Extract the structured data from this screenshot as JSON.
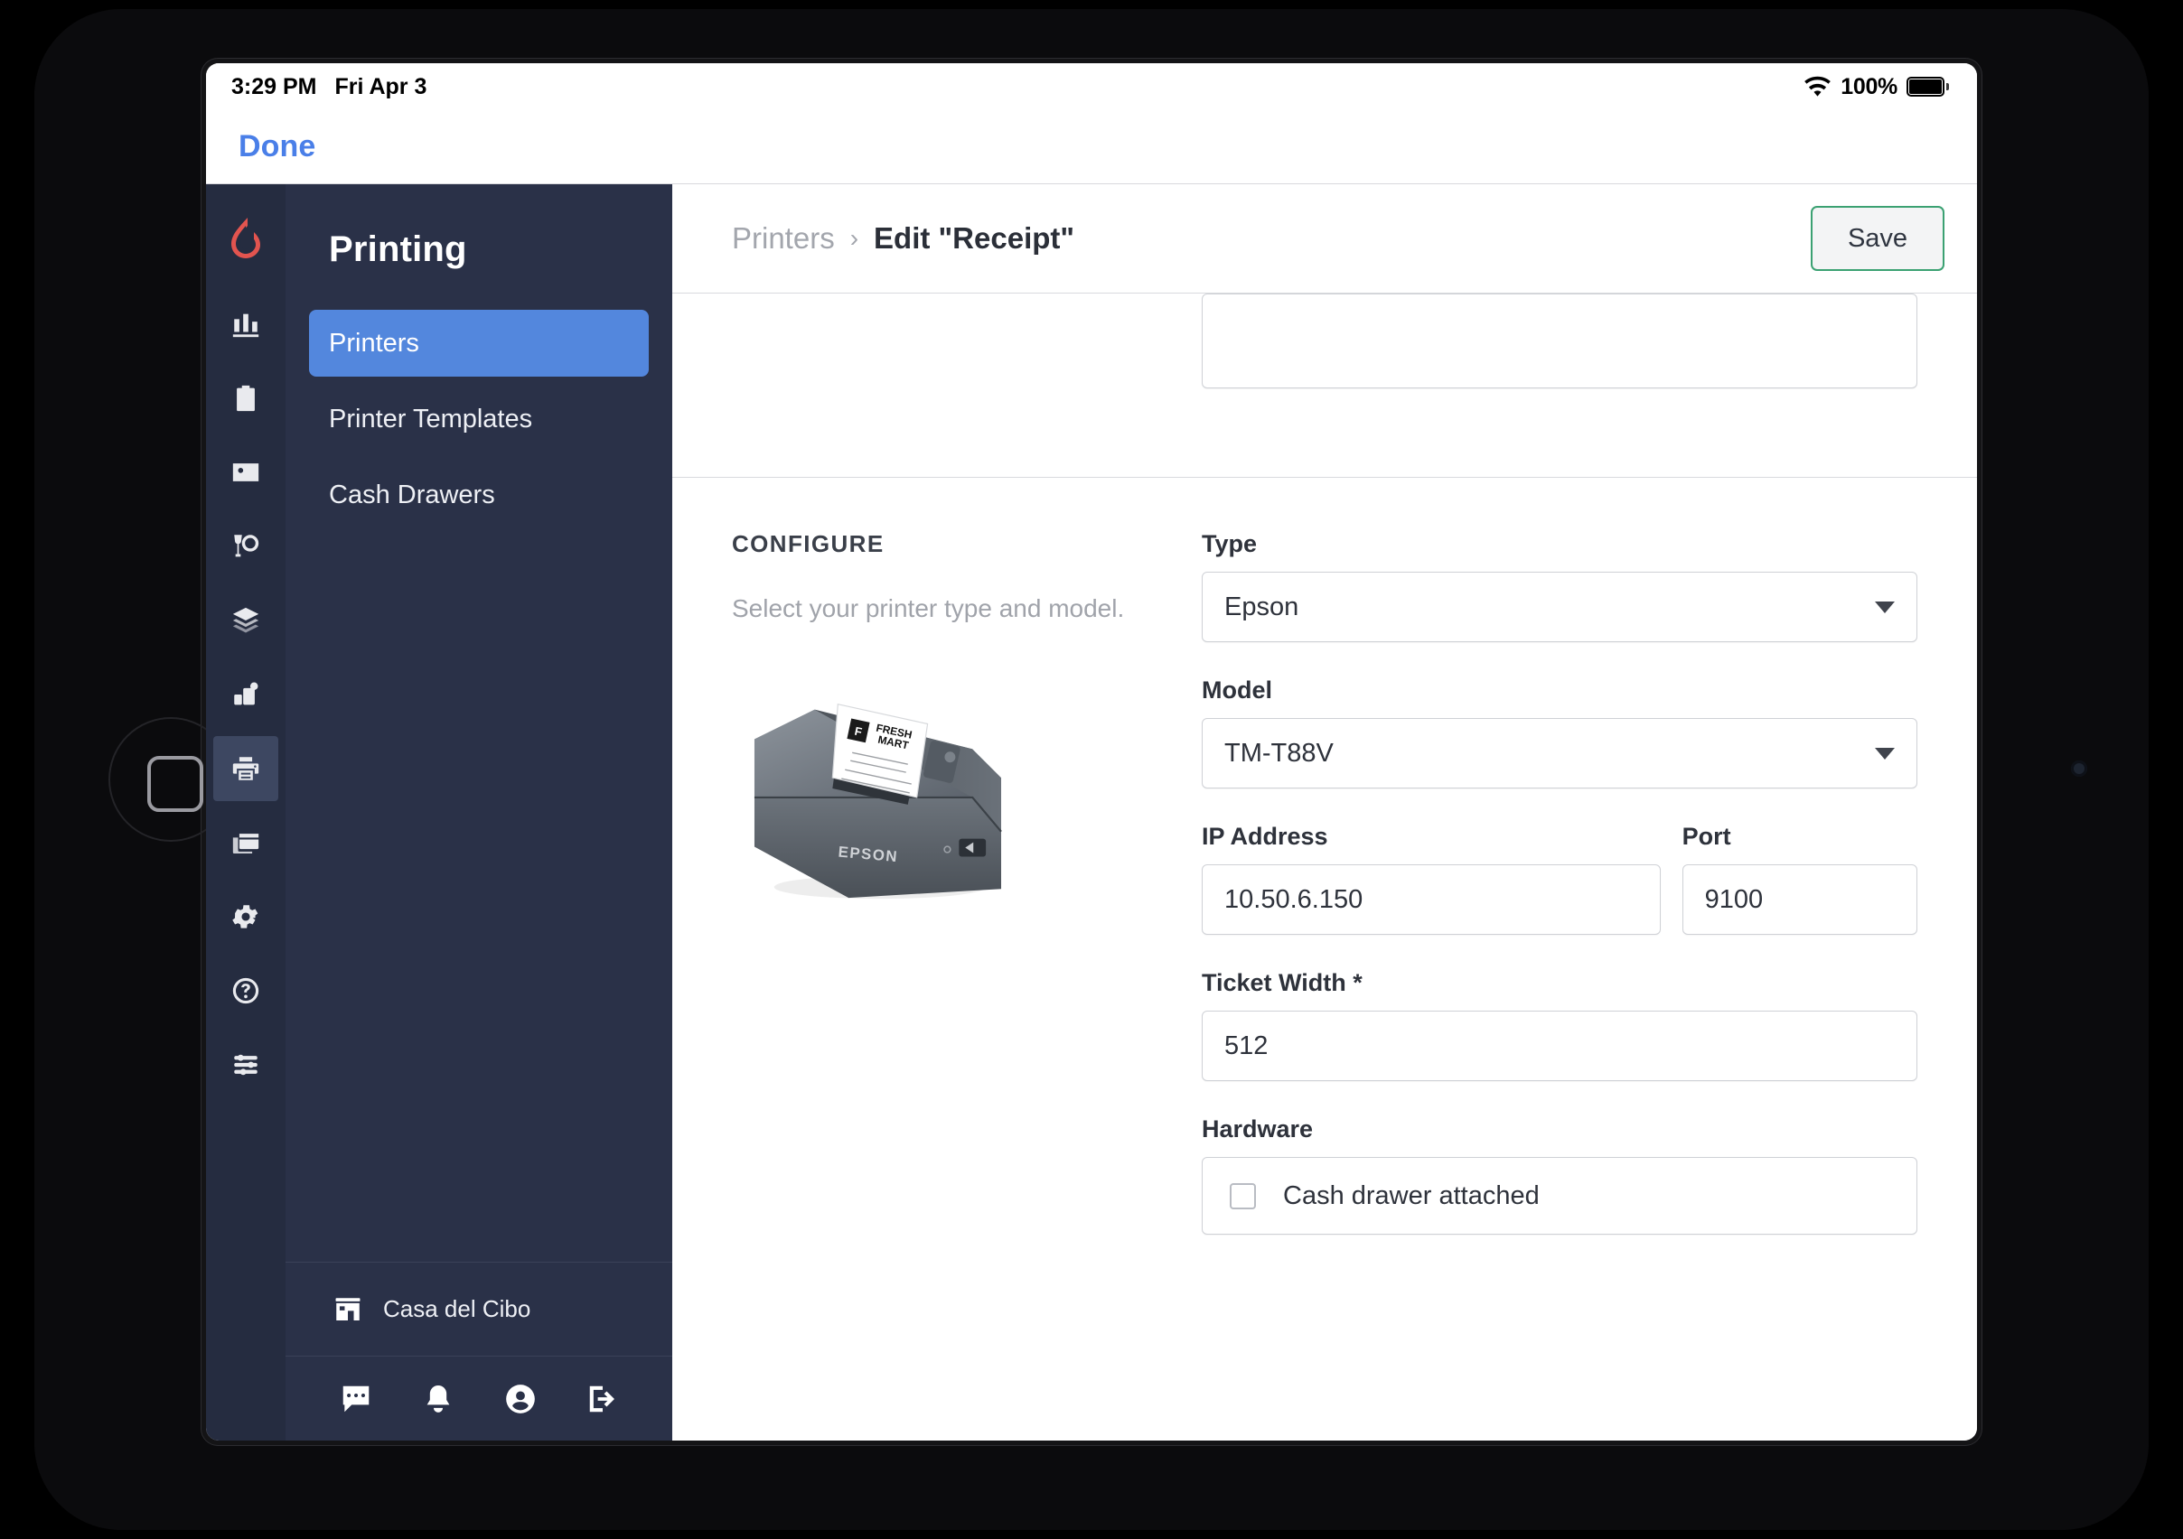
{
  "status_bar": {
    "time": "3:29 PM",
    "date": "Fri Apr 3",
    "battery_percent": "100%",
    "wifi_icon": "wifi-icon",
    "battery_icon": "battery-full-icon"
  },
  "toolbar": {
    "done_label": "Done"
  },
  "sidebar": {
    "logo_icon": "lightspeed-flame-logo",
    "title": "Printing",
    "rail_items": [
      {
        "icon": "bar-chart-icon",
        "active": false
      },
      {
        "icon": "clipboard-icon",
        "active": false
      },
      {
        "icon": "contact-card-icon",
        "active": false
      },
      {
        "icon": "dining-glass-plate-icon",
        "active": false
      },
      {
        "icon": "layers-icon",
        "active": false
      },
      {
        "icon": "devices-icon",
        "active": false
      },
      {
        "icon": "printer-icon",
        "active": true
      },
      {
        "icon": "payment-cards-icon",
        "active": false
      },
      {
        "icon": "gear-icon",
        "active": false
      },
      {
        "icon": "help-circle-icon",
        "active": false
      },
      {
        "icon": "sliders-list-icon",
        "active": false
      }
    ],
    "items": [
      {
        "label": "Printers",
        "active": true
      },
      {
        "label": "Printer Templates",
        "active": false
      },
      {
        "label": "Cash Drawers",
        "active": false
      }
    ],
    "store": {
      "icon": "storefront-icon",
      "name": "Casa del Cibo"
    },
    "footer_icons": [
      "chat-message-icon",
      "notification-bell-icon",
      "account-person-icon",
      "logout-icon"
    ]
  },
  "header": {
    "breadcrumb_parent": "Printers",
    "breadcrumb_separator": "›",
    "breadcrumb_current": "Edit \"Receipt\"",
    "save_label": "Save"
  },
  "configure": {
    "title": "CONFIGURE",
    "description": "Select your printer type and model.",
    "image_alt": "epson-thermal-printer-photo",
    "receipt_brand_line1": "FRESH",
    "receipt_brand_line2": "MART",
    "printer_brand_label": "EPSON"
  },
  "form": {
    "type": {
      "label": "Type",
      "value": "Epson"
    },
    "model": {
      "label": "Model",
      "value": "TM-T88V"
    },
    "ip_address": {
      "label": "IP Address",
      "value": "10.50.6.150"
    },
    "port": {
      "label": "Port",
      "value": "9100"
    },
    "ticket_width": {
      "label": "Ticket Width *",
      "value": "512"
    },
    "hardware": {
      "label": "Hardware",
      "checkbox_label": "Cash drawer attached",
      "checked": false
    }
  },
  "colors": {
    "sidebar_rail": "#252c40",
    "sidebar_panel": "#2a3148",
    "nav_active": "#5387dd",
    "logo_red": "#e2544f",
    "save_border_green": "#3ba172",
    "done_blue": "#4a7fe8"
  }
}
